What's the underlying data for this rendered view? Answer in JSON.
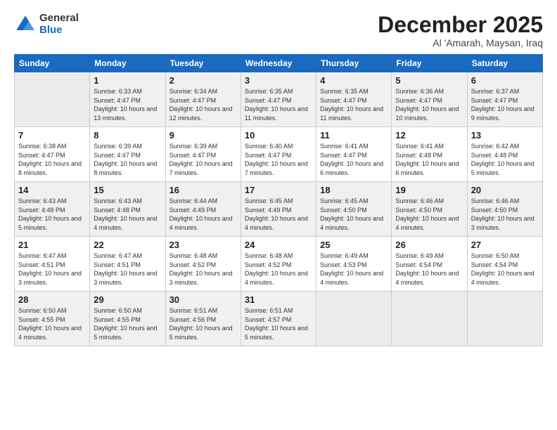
{
  "logo": {
    "general": "General",
    "blue": "Blue"
  },
  "title": "December 2025",
  "subtitle": "Al 'Amarah, Maysan, Iraq",
  "headers": [
    "Sunday",
    "Monday",
    "Tuesday",
    "Wednesday",
    "Thursday",
    "Friday",
    "Saturday"
  ],
  "weeks": [
    [
      {
        "day": "",
        "empty": true
      },
      {
        "day": "1",
        "sunrise": "6:33 AM",
        "sunset": "4:47 PM",
        "daylight": "10 hours and 13 minutes."
      },
      {
        "day": "2",
        "sunrise": "6:34 AM",
        "sunset": "4:47 PM",
        "daylight": "10 hours and 12 minutes."
      },
      {
        "day": "3",
        "sunrise": "6:35 AM",
        "sunset": "4:47 PM",
        "daylight": "10 hours and 11 minutes."
      },
      {
        "day": "4",
        "sunrise": "6:35 AM",
        "sunset": "4:47 PM",
        "daylight": "10 hours and 11 minutes."
      },
      {
        "day": "5",
        "sunrise": "6:36 AM",
        "sunset": "4:47 PM",
        "daylight": "10 hours and 10 minutes."
      },
      {
        "day": "6",
        "sunrise": "6:37 AM",
        "sunset": "4:47 PM",
        "daylight": "10 hours and 9 minutes."
      }
    ],
    [
      {
        "day": "7",
        "sunrise": "6:38 AM",
        "sunset": "4:47 PM",
        "daylight": "10 hours and 8 minutes."
      },
      {
        "day": "8",
        "sunrise": "6:39 AM",
        "sunset": "4:47 PM",
        "daylight": "10 hours and 8 minutes."
      },
      {
        "day": "9",
        "sunrise": "6:39 AM",
        "sunset": "4:47 PM",
        "daylight": "10 hours and 7 minutes."
      },
      {
        "day": "10",
        "sunrise": "6:40 AM",
        "sunset": "4:47 PM",
        "daylight": "10 hours and 7 minutes."
      },
      {
        "day": "11",
        "sunrise": "6:41 AM",
        "sunset": "4:47 PM",
        "daylight": "10 hours and 6 minutes."
      },
      {
        "day": "12",
        "sunrise": "6:41 AM",
        "sunset": "4:48 PM",
        "daylight": "10 hours and 6 minutes."
      },
      {
        "day": "13",
        "sunrise": "6:42 AM",
        "sunset": "4:48 PM",
        "daylight": "10 hours and 5 minutes."
      }
    ],
    [
      {
        "day": "14",
        "sunrise": "6:43 AM",
        "sunset": "4:48 PM",
        "daylight": "10 hours and 5 minutes."
      },
      {
        "day": "15",
        "sunrise": "6:43 AM",
        "sunset": "4:48 PM",
        "daylight": "10 hours and 4 minutes."
      },
      {
        "day": "16",
        "sunrise": "6:44 AM",
        "sunset": "4:49 PM",
        "daylight": "10 hours and 4 minutes."
      },
      {
        "day": "17",
        "sunrise": "6:45 AM",
        "sunset": "4:49 PM",
        "daylight": "10 hours and 4 minutes."
      },
      {
        "day": "18",
        "sunrise": "6:45 AM",
        "sunset": "4:50 PM",
        "daylight": "10 hours and 4 minutes."
      },
      {
        "day": "19",
        "sunrise": "6:46 AM",
        "sunset": "4:50 PM",
        "daylight": "10 hours and 4 minutes."
      },
      {
        "day": "20",
        "sunrise": "6:46 AM",
        "sunset": "4:50 PM",
        "daylight": "10 hours and 3 minutes."
      }
    ],
    [
      {
        "day": "21",
        "sunrise": "6:47 AM",
        "sunset": "4:51 PM",
        "daylight": "10 hours and 3 minutes."
      },
      {
        "day": "22",
        "sunrise": "6:47 AM",
        "sunset": "4:51 PM",
        "daylight": "10 hours and 3 minutes."
      },
      {
        "day": "23",
        "sunrise": "6:48 AM",
        "sunset": "4:52 PM",
        "daylight": "10 hours and 3 minutes."
      },
      {
        "day": "24",
        "sunrise": "6:48 AM",
        "sunset": "4:52 PM",
        "daylight": "10 hours and 4 minutes."
      },
      {
        "day": "25",
        "sunrise": "6:49 AM",
        "sunset": "4:53 PM",
        "daylight": "10 hours and 4 minutes."
      },
      {
        "day": "26",
        "sunrise": "6:49 AM",
        "sunset": "4:54 PM",
        "daylight": "10 hours and 4 minutes."
      },
      {
        "day": "27",
        "sunrise": "6:50 AM",
        "sunset": "4:54 PM",
        "daylight": "10 hours and 4 minutes."
      }
    ],
    [
      {
        "day": "28",
        "sunrise": "6:50 AM",
        "sunset": "4:55 PM",
        "daylight": "10 hours and 4 minutes."
      },
      {
        "day": "29",
        "sunrise": "6:50 AM",
        "sunset": "4:55 PM",
        "daylight": "10 hours and 5 minutes."
      },
      {
        "day": "30",
        "sunrise": "6:51 AM",
        "sunset": "4:56 PM",
        "daylight": "10 hours and 5 minutes."
      },
      {
        "day": "31",
        "sunrise": "6:51 AM",
        "sunset": "4:57 PM",
        "daylight": "10 hours and 5 minutes."
      },
      {
        "day": "",
        "empty": true
      },
      {
        "day": "",
        "empty": true
      },
      {
        "day": "",
        "empty": true
      }
    ]
  ]
}
